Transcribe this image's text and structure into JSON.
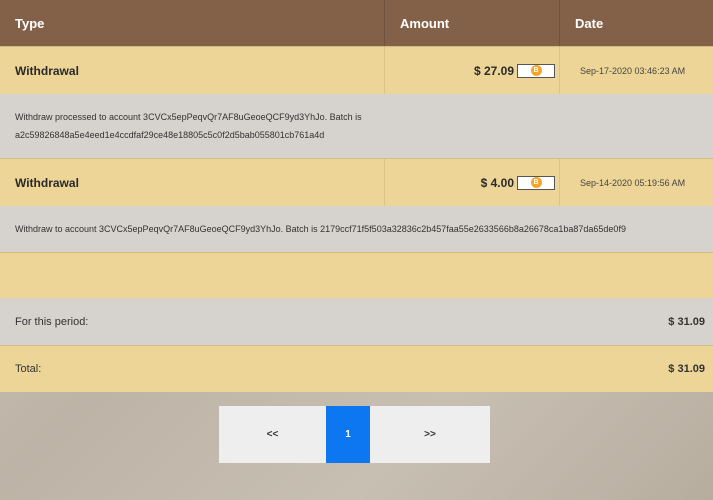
{
  "columns": {
    "type": "Type",
    "amount": "Amount",
    "date": "Date"
  },
  "transactions": [
    {
      "type": "Withdrawal",
      "amount": "$ 27.09",
      "date": "Sep-17-2020 03:46:23 AM",
      "detail_line1": "Withdraw processed to account 3CVCx5epPeqvQr7AF8uGeoeQCF9yd3YhJo. Batch is",
      "detail_line2": "a2c59826848a5e4eed1e4ccdfaf29ce48e18805c5c0f2d5bab055801cb761a4d"
    },
    {
      "type": "Withdrawal",
      "amount": "$ 4.00",
      "date": "Sep-14-2020 05:19:56 AM",
      "detail_line1": "Withdraw to account 3CVCx5epPeqvQr7AF8uGeoeQCF9yd3YhJo. Batch is 2179ccf71f5f503a32836c2b457faa55e2633566b8a26678ca1ba87da65de0f9"
    }
  ],
  "coin_symbol": "B",
  "summary": {
    "period_label": "For this period:",
    "period_value": "$ 31.09",
    "total_label": "Total:",
    "total_value": "$ 31.09"
  },
  "pagination": {
    "prev": "<<",
    "current": "1",
    "next": ">>"
  },
  "colors": {
    "header": "#836149",
    "row": "#ecd596",
    "detail": "#d6d2cd",
    "active_page": "#0d76f1",
    "coin": "#f4a52a"
  }
}
